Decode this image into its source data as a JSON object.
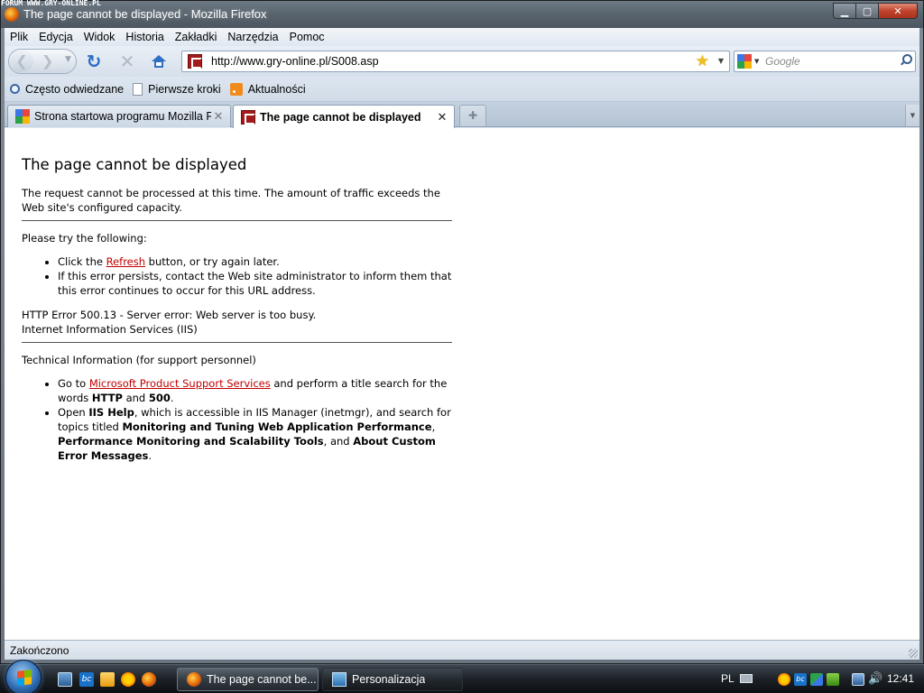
{
  "watermark": "FORUM WWW.GRY-ONLINE.PL",
  "window": {
    "title": "The page cannot be displayed - Mozilla Firefox",
    "minimize": "▁",
    "maximize": "▢",
    "close": "✕"
  },
  "menu": [
    "Plik",
    "Edycja",
    "Widok",
    "Historia",
    "Zakładki",
    "Narzędzia",
    "Pomoc"
  ],
  "nav": {
    "back_icon": "back-arrow-icon",
    "forward_icon": "forward-arrow-icon",
    "reload_icon": "reload-icon",
    "stop_icon": "stop-icon",
    "home_icon": "home-icon",
    "url": "http://www.gry-online.pl/S008.asp",
    "search_placeholder": "Google"
  },
  "bookmarks": [
    "Często odwiedzane",
    "Pierwsze kroki",
    "Aktualności"
  ],
  "tabs": [
    {
      "label": "Strona startowa programu Mozilla F...",
      "active": false
    },
    {
      "label": "The page cannot be displayed",
      "active": true
    }
  ],
  "page": {
    "heading": "The page cannot be displayed",
    "intro": "The request cannot be processed at this time. The amount of traffic exceeds the Web site's configured capacity.",
    "try_heading": "Please try the following:",
    "try1_pre": "Click the ",
    "try1_link": "Refresh",
    "try1_post": " button, or try again later.",
    "try2": "If this error persists, contact the Web site administrator to inform them that this error continues to occur for this URL address.",
    "error_line": "HTTP Error 500.13 - Server error: Web server is too busy.",
    "server_line": "Internet Information Services (IIS)",
    "tech_heading": "Technical Information (for support personnel)",
    "tech1_pre": "Go to ",
    "tech1_link": "Microsoft Product Support Services",
    "tech1_mid": " and perform a title search for the words ",
    "tech1_b1": "HTTP",
    "tech1_and": " and ",
    "tech1_b2": "500",
    "tech1_end": ".",
    "tech2_pre": "Open ",
    "tech2_b1": "IIS Help",
    "tech2_mid": ", which is accessible in IIS Manager (inetmgr), and search for topics titled ",
    "tech2_b2": "Monitoring and Tuning Web Application Performance",
    "tech2_c1": ", ",
    "tech2_b3": "Performance Monitoring and Scalability Tools",
    "tech2_c2": ", and ",
    "tech2_b4": "About Custom Error Messages",
    "tech2_end": "."
  },
  "status": "Zakończono",
  "taskbar": {
    "tasks": [
      "The page cannot be...",
      "Personalizacja"
    ],
    "language": "PL",
    "clock": "12:41",
    "bc_label": "bc"
  },
  "colors": {
    "link": "#c00000",
    "titlebar": "#58636d"
  }
}
